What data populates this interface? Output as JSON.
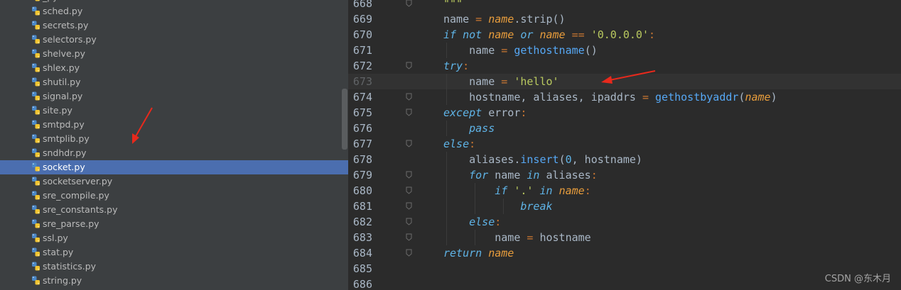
{
  "sidebar": {
    "files": [
      {
        "name": "_py"
      },
      {
        "name": "sched.py"
      },
      {
        "name": "secrets.py"
      },
      {
        "name": "selectors.py"
      },
      {
        "name": "shelve.py"
      },
      {
        "name": "shlex.py"
      },
      {
        "name": "shutil.py"
      },
      {
        "name": "signal.py"
      },
      {
        "name": "site.py"
      },
      {
        "name": "smtpd.py"
      },
      {
        "name": "smtplib.py"
      },
      {
        "name": "sndhdr.py"
      },
      {
        "name": "socket.py",
        "selected": true
      },
      {
        "name": "socketserver.py"
      },
      {
        "name": "sre_compile.py"
      },
      {
        "name": "sre_constants.py"
      },
      {
        "name": "sre_parse.py"
      },
      {
        "name": "ssl.py"
      },
      {
        "name": "stat.py"
      },
      {
        "name": "statistics.py"
      },
      {
        "name": "string.py"
      }
    ]
  },
  "editor": {
    "lines": [
      {
        "num": "668",
        "fold": true,
        "tokens": [
          {
            "t": "\"\"\"",
            "c": "str"
          }
        ]
      },
      {
        "num": "669",
        "tokens": [
          {
            "t": "name",
            "c": "text"
          },
          {
            "t": " = ",
            "c": "op"
          },
          {
            "t": "name",
            "c": "param"
          },
          {
            "t": ".strip()",
            "c": "text"
          }
        ]
      },
      {
        "num": "670",
        "tokens": [
          {
            "t": "if not ",
            "c": "kw"
          },
          {
            "t": "name",
            "c": "param"
          },
          {
            "t": " or ",
            "c": "kw"
          },
          {
            "t": "name",
            "c": "param"
          },
          {
            "t": " == ",
            "c": "op"
          },
          {
            "t": "'0.0.0.0'",
            "c": "str"
          },
          {
            "t": ":",
            "c": "op"
          }
        ]
      },
      {
        "num": "671",
        "tokens": [
          {
            "t": "    name",
            "c": "text"
          },
          {
            "t": " = ",
            "c": "op"
          },
          {
            "t": "gethostname",
            "c": "fn"
          },
          {
            "t": "()",
            "c": "text"
          }
        ]
      },
      {
        "num": "672",
        "fold": true,
        "tokens": [
          {
            "t": "try",
            "c": "kw"
          },
          {
            "t": ":",
            "c": "op"
          }
        ]
      },
      {
        "num": "673",
        "current": true,
        "tokens": [
          {
            "t": "    name",
            "c": "text"
          },
          {
            "t": " = ",
            "c": "op"
          },
          {
            "t": "'hello'",
            "c": "str"
          }
        ]
      },
      {
        "num": "674",
        "fold": true,
        "tokens": [
          {
            "t": "    hostname, aliases, ipaddrs",
            "c": "text"
          },
          {
            "t": " = ",
            "c": "op"
          },
          {
            "t": "gethostbyaddr",
            "c": "fn"
          },
          {
            "t": "(",
            "c": "text"
          },
          {
            "t": "name",
            "c": "param"
          },
          {
            "t": ")",
            "c": "text"
          }
        ]
      },
      {
        "num": "675",
        "fold": true,
        "tokens": [
          {
            "t": "except ",
            "c": "kw"
          },
          {
            "t": "error",
            "c": "text"
          },
          {
            "t": ":",
            "c": "op"
          }
        ]
      },
      {
        "num": "676",
        "tokens": [
          {
            "t": "    ",
            "c": "text"
          },
          {
            "t": "pass",
            "c": "kw"
          }
        ]
      },
      {
        "num": "677",
        "fold": true,
        "tokens": [
          {
            "t": "else",
            "c": "kw"
          },
          {
            "t": ":",
            "c": "op"
          }
        ]
      },
      {
        "num": "678",
        "tokens": [
          {
            "t": "    aliases.",
            "c": "text"
          },
          {
            "t": "insert",
            "c": "fn"
          },
          {
            "t": "(",
            "c": "text"
          },
          {
            "t": "0",
            "c": "num"
          },
          {
            "t": ", hostname)",
            "c": "text"
          }
        ]
      },
      {
        "num": "679",
        "fold": true,
        "tokens": [
          {
            "t": "    ",
            "c": "text"
          },
          {
            "t": "for ",
            "c": "kw"
          },
          {
            "t": "name ",
            "c": "text"
          },
          {
            "t": "in ",
            "c": "kw"
          },
          {
            "t": "aliases",
            "c": "text"
          },
          {
            "t": ":",
            "c": "op"
          }
        ]
      },
      {
        "num": "680",
        "fold": true,
        "tokens": [
          {
            "t": "        ",
            "c": "text"
          },
          {
            "t": "if ",
            "c": "kw"
          },
          {
            "t": "'.'",
            "c": "str"
          },
          {
            "t": " in ",
            "c": "kw"
          },
          {
            "t": "name",
            "c": "param"
          },
          {
            "t": ":",
            "c": "op"
          }
        ]
      },
      {
        "num": "681",
        "fold": true,
        "tokens": [
          {
            "t": "            ",
            "c": "text"
          },
          {
            "t": "break",
            "c": "kw"
          }
        ]
      },
      {
        "num": "682",
        "fold": true,
        "tokens": [
          {
            "t": "    ",
            "c": "text"
          },
          {
            "t": "else",
            "c": "kw"
          },
          {
            "t": ":",
            "c": "op"
          }
        ]
      },
      {
        "num": "683",
        "fold": true,
        "tokens": [
          {
            "t": "        name",
            "c": "text"
          },
          {
            "t": " = ",
            "c": "op"
          },
          {
            "t": "hostname",
            "c": "text"
          }
        ]
      },
      {
        "num": "684",
        "fold": true,
        "tokens": [
          {
            "t": "return ",
            "c": "kw"
          },
          {
            "t": "name",
            "c": "param"
          }
        ]
      },
      {
        "num": "685",
        "tokens": []
      },
      {
        "num": "686",
        "tokens": []
      }
    ]
  },
  "watermark": "CSDN @东木月",
  "colors": {
    "sidebar_bg": "#3c3f41",
    "selection": "#4b6eaf",
    "editor_bg": "#2b2b2b",
    "arrow": "#e8291c"
  },
  "icons": {
    "file": "python-file-icon",
    "fold": "fold-marker-icon"
  }
}
